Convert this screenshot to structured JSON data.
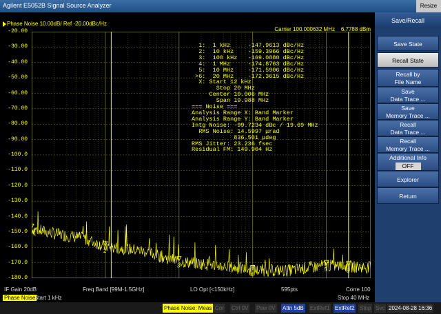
{
  "app": {
    "title": "Agilent E5052B Signal Source Analyzer",
    "resize_label": "Resize"
  },
  "graph": {
    "header": "Phase Noise 10.00dB/ Ref -20.00dBc/Hz",
    "carrier": "Carrier 100.000632 MHz",
    "carrier_power": "6.7788 dBm",
    "y_labels": [
      "-20.00",
      "-30.00",
      "-40.00",
      "-50.00",
      "-60.00",
      "-70.00",
      "-80.00",
      "-90.00",
      "-100.0",
      "-110.0",
      "-120.0",
      "-130.0",
      "-140.0",
      "-150.0",
      "-160.0",
      "-170.0",
      "-180.0"
    ],
    "markers": [
      "  1:  1 kHz     -147.9613 dBc/Hz",
      "  2:  10 kHz    -159.3966 dBc/Hz",
      "  3:  100 kHz   -169.0880 dBc/Hz",
      "  4:  1 MHz     -174.8763 dBc/Hz",
      "  5:  10 MHz    -171.5906 dBc/Hz",
      " >6:  20 MHz    -172.3615 dBc/Hz",
      "  X: Start 12 kHz",
      "       Stop 20 MHz",
      "     Center 10.006 MHz",
      "       Span 19.988 MHz",
      "=== Noise ===",
      "Analysis Range X: Band Marker",
      "Analysis Range Y: Band Marker",
      "Intg Noise: -99.7234 dBc / 19.69 MHz",
      "  RMS Noise: 14.5997 μrad",
      "            836.501 μdeg",
      "RMS Jitter: 23.236 fsec",
      "Residual FM: 149.904 Hz"
    ],
    "marker_labels": [
      "1",
      "2",
      "3",
      "4",
      "5",
      "6"
    ]
  },
  "status_row": {
    "if_gain": "IF Gain 20dB",
    "freq_band": "Freq Band [99M-1.5GHz]",
    "lo_opt": "LO Opt [<150kHz]",
    "points": "595pts",
    "corre": "Corre 100"
  },
  "sweep_row": {
    "tab": "Phase Noise",
    "start": "Start 1 kHz",
    "stop": "Stop 40 MHz"
  },
  "softkeys": {
    "title": "Save/Recall",
    "items": [
      {
        "line1": "Save State",
        "line2": ""
      },
      {
        "line1": "Recall State",
        "line2": ""
      },
      {
        "line1": "Recall by",
        "line2": "File Name"
      },
      {
        "line1": "Save",
        "line2": "Data Trace ..."
      },
      {
        "line1": "Save",
        "line2": "Memory Trace ..."
      },
      {
        "line1": "Recall",
        "line2": "Data Trace ..."
      },
      {
        "line1": "Recall",
        "line2": "Memory Trace ..."
      },
      {
        "line1": "Additional Info",
        "line2": "OFF"
      },
      {
        "line1": "Explorer",
        "line2": ""
      },
      {
        "line1": "Return",
        "line2": ""
      }
    ]
  },
  "bottom": {
    "meas": "Phase Noise: Meas",
    "cor": "Cor",
    "ctrl": "Ctrl 0V",
    "pow": "Pow 0V",
    "attn": "Attn 5dB",
    "extref1": "ExtRef1",
    "extref2": "ExtRef2",
    "stop": "Stop",
    "svc": "Svc",
    "datetime": "2024-08-28 16:36"
  },
  "colors": {
    "trace": "#ffff00",
    "grid": "#7a7a2a",
    "softkey": "#2b4d82"
  }
}
